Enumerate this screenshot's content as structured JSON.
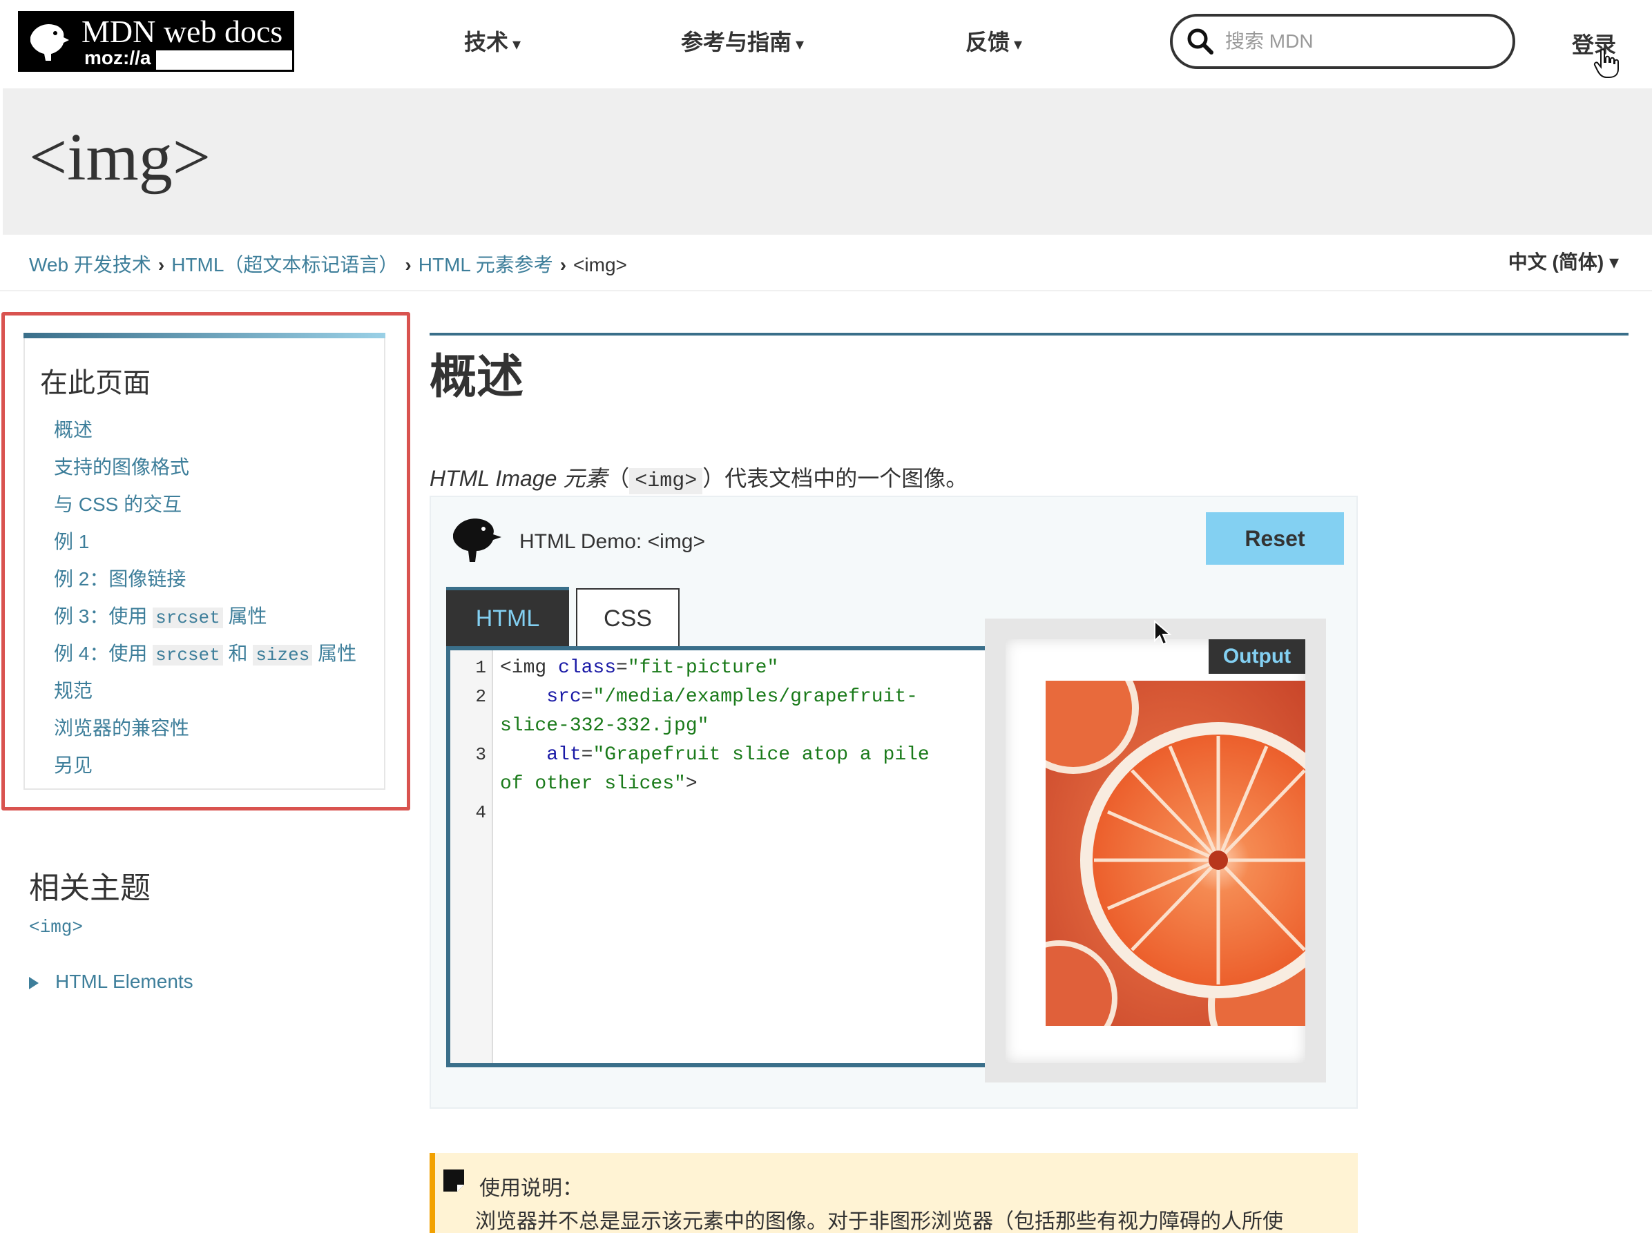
{
  "header": {
    "logo_main": "MDN web docs",
    "logo_sub": "moz://a",
    "nav": [
      "技术",
      "参考与指南",
      "反馈"
    ],
    "caret": "▾",
    "search_placeholder": "搜索 MDN",
    "login": "登录"
  },
  "page": {
    "title": "<img>"
  },
  "breadcrumb": {
    "items": [
      "Web 开发技术",
      "HTML（超文本标记语言）",
      "HTML 元素参考"
    ],
    "sep": "›",
    "current": "<img>"
  },
  "language": "中文 (简体) ▾",
  "toc": {
    "title": "在此页面",
    "items": [
      {
        "text": "概述"
      },
      {
        "text": "支持的图像格式"
      },
      {
        "text": "与 CSS 的交互"
      },
      {
        "text": "例 1"
      },
      {
        "text": "例 2：图像链接"
      },
      {
        "pre": "例 3：使用 ",
        "code": "srcset",
        "post": " 属性"
      },
      {
        "pre": "例 4：使用 ",
        "code": "srcset",
        "mid": " 和 ",
        "code2": "sizes",
        "post": " 属性"
      },
      {
        "text": "规范"
      },
      {
        "text": "浏览器的兼容性"
      },
      {
        "text": "另见"
      }
    ]
  },
  "related": {
    "title": "相关主题",
    "code": "<img>",
    "item": "HTML Elements"
  },
  "main": {
    "heading": "概述",
    "intro_em": "HTML Image 元素",
    "intro_open": "（",
    "intro_code": "<img>",
    "intro_close": "）代表文档中的一个图像。"
  },
  "demo": {
    "title": "HTML Demo: <img>",
    "reset": "Reset",
    "tab_html": "HTML",
    "tab_css": "CSS",
    "output_label": "Output",
    "line_numbers": [
      "1",
      "2",
      "3",
      "4"
    ],
    "code": {
      "l1_tag": "<img ",
      "l1_attr": "class",
      "l1_eq": "=",
      "l1_val": "\"fit-picture\"",
      "l2_attr": "src",
      "l2_eq": "=",
      "l2_val": "\"/media/examples/grapefruit-",
      "l2b_val": "slice-332-332.jpg\"",
      "l3_attr": "alt",
      "l3_eq": "=",
      "l3_val": "\"Grapefruit slice atop a pile",
      "l3b_val": "of other slices\"",
      "l3b_tag": ">"
    }
  },
  "note": {
    "title": "使用说明：",
    "body": "浏览器并不总是显示该元素中的图像。对于非图形浏览器（包括那些有视力障碍的人所使"
  },
  "colors": {
    "link": "#3d7e9a",
    "accent": "#3a6f8a",
    "reset_bg": "#83d0f2",
    "highlight": "#d9534f",
    "note_border": "#f2a100"
  }
}
